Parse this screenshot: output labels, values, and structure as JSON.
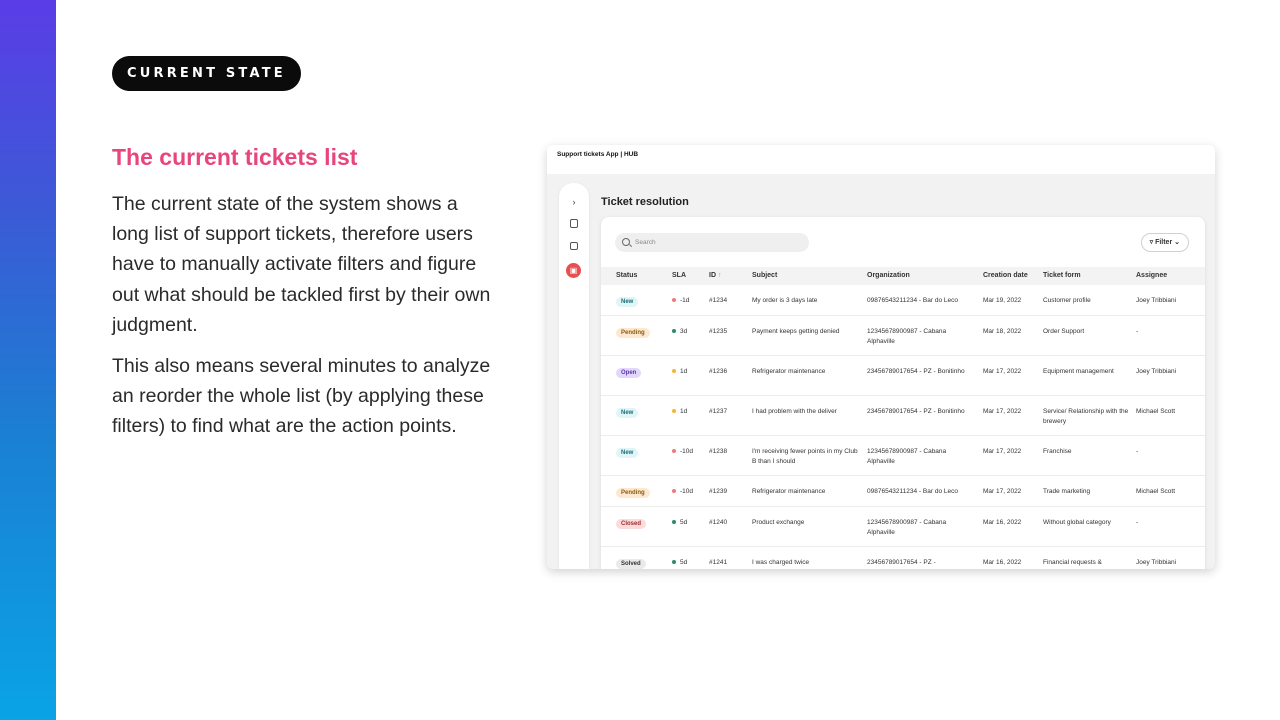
{
  "slide": {
    "tag": "CURRENT STATE",
    "heading": "The current tickets list",
    "paragraph1": "The current state of the system shows a long list of support tickets, therefore users have to manually activate filters and figure out what should be tackled first by their own judgment.",
    "paragraph2": "This also means several minutes to analyze an reorder the whole list (by applying these filters) to find what are the action points.",
    "colors": {
      "heading": "#e8457a",
      "pill_bg": "#0b0b0b",
      "gradient_top": "#5a3de6",
      "gradient_bottom": "#0aa3e6"
    }
  },
  "app": {
    "window_title": "Support tickets App | HUB",
    "page_title": "Ticket resolution",
    "sidebar_icons": [
      "chevron-right-icon",
      "contact-icon",
      "copy-icon",
      "tickets-icon"
    ],
    "search_placeholder": "Search",
    "filter_label": "Filter",
    "columns": {
      "status": "Status",
      "sla": "SLA",
      "id": "ID",
      "id_sort_icon": "↑",
      "subject": "Subject",
      "organization": "Organization",
      "date": "Creation date",
      "form": "Ticket form",
      "assignee": "Assignee"
    },
    "rows": [
      {
        "status": "New",
        "status_color": "#dff5f7",
        "status_text": "#1c6b74",
        "sla": "-1d",
        "sla_dot": "#f07a7a",
        "id": "#1234",
        "subject": "My order is 3 days late",
        "organization": "09876543211234 - Bar do Leco",
        "date": "Mar 19, 2022",
        "form": "Customer profile",
        "assignee": "Joey Tribbiani"
      },
      {
        "status": "Pending",
        "status_color": "#fde9cf",
        "status_text": "#8a5a12",
        "sla": "3d",
        "sla_dot": "#2f8a6b",
        "id": "#1235",
        "subject": "Payment keeps getting denied",
        "organization": "12345678900987 - Cabana Alphaville",
        "date": "Mar 18, 2022",
        "form": "Order Support",
        "assignee": "-"
      },
      {
        "status": "Open",
        "status_color": "#e3d7fb",
        "status_text": "#5a35b0",
        "sla": "1d",
        "sla_dot": "#f2b632",
        "id": "#1236",
        "subject": "Refrigerator maintenance",
        "organization": "23456789017654 - PZ - Bonitinho",
        "date": "Mar 17, 2022",
        "form": "Equipment management",
        "assignee": "Joey Tribbiani"
      },
      {
        "status": "New",
        "status_color": "#dff5f7",
        "status_text": "#1c6b74",
        "sla": "1d",
        "sla_dot": "#f2b632",
        "id": "#1237",
        "subject": "I had problem with the deliver",
        "organization": "23456789017654 - PZ - Bonitinho",
        "date": "Mar 17, 2022",
        "form": "Service/ Relationship with the brewery",
        "assignee": "Michael Scott"
      },
      {
        "status": "New",
        "status_color": "#dff5f7",
        "status_text": "#1c6b74",
        "sla": "-10d",
        "sla_dot": "#f07a7a",
        "id": "#1238",
        "subject": "I'm receiving fewer points in my Club B than I should",
        "organization": "12345678900987 - Cabana Alphaville",
        "date": "Mar 17, 2022",
        "form": "Franchise",
        "assignee": "-"
      },
      {
        "status": "Pending",
        "status_color": "#fde9cf",
        "status_text": "#8a5a12",
        "sla": "-10d",
        "sla_dot": "#f07a7a",
        "id": "#1239",
        "subject": "Refrigerator maintenance",
        "organization": "09876543211234 - Bar do Leco",
        "date": "Mar 17, 2022",
        "form": "Trade marketing",
        "assignee": "Michael Scott"
      },
      {
        "status": "Closed",
        "status_color": "#fbdcdc",
        "status_text": "#a12b2b",
        "sla": "5d",
        "sla_dot": "#2f8a6b",
        "id": "#1240",
        "subject": "Product exchange",
        "organization": "12345678900987 - Cabana Alphaville",
        "date": "Mar 16, 2022",
        "form": "Without global category",
        "assignee": "-"
      },
      {
        "status": "Solved",
        "status_color": "#eaeaea",
        "status_text": "#333333",
        "sla": "5d",
        "sla_dot": "#2f8a6b",
        "id": "#1241",
        "subject": "I was charged twice",
        "organization": "23456789017654 - PZ -",
        "date": "Mar 16, 2022",
        "form": "Financial requests &",
        "assignee": "Joey Tribbiani"
      }
    ]
  }
}
